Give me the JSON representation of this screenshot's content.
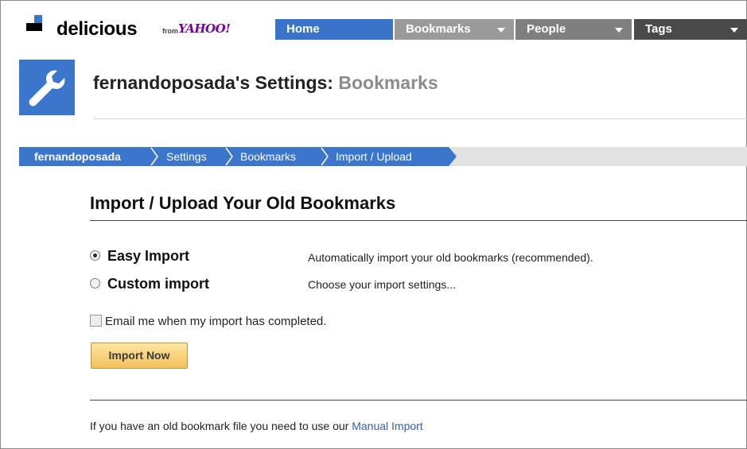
{
  "header": {
    "brand": "delicious",
    "from_label": "from",
    "yahoo_label": "YAHOO!",
    "nav": [
      {
        "label": "Home"
      },
      {
        "label": "Bookmarks"
      },
      {
        "label": "People"
      },
      {
        "label": "Tags"
      }
    ]
  },
  "settings": {
    "title_user": "fernandoposada's Settings:",
    "title_section": "Bookmarks"
  },
  "breadcrumb": [
    "fernandoposada",
    "Settings",
    "Bookmarks",
    "Import / Upload"
  ],
  "main": {
    "heading": "Import / Upload Your Old Bookmarks",
    "options": [
      {
        "label": "Easy Import",
        "description": "Automatically import your old bookmarks (recommended).",
        "selected": true
      },
      {
        "label": "Custom import",
        "description": "Choose your import settings...",
        "selected": false
      }
    ],
    "email_checkbox_label": "Email me when my import has completed.",
    "email_checked": false,
    "import_button": "Import Now",
    "footer_text": "If you have an old bookmark file you need to use our",
    "footer_link": "Manual Import"
  },
  "colors": {
    "nav_home": "#3974c9",
    "breadcrumb_blue": "#3b75cc",
    "button_gold": "#f2c15c",
    "link": "#2f5fb3"
  }
}
